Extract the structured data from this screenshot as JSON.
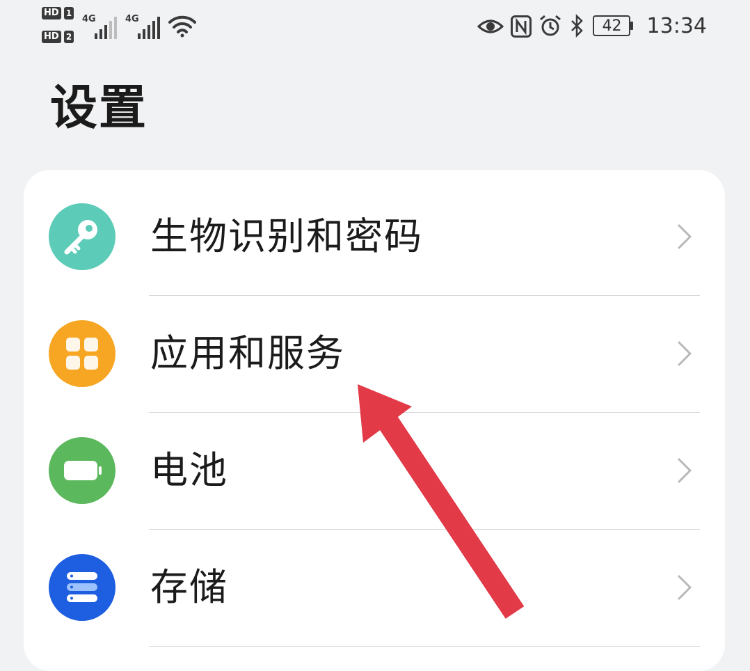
{
  "status_bar": {
    "sim1": {
      "hd": "HD",
      "slot": "1"
    },
    "sim2": {
      "hd": "HD",
      "slot": "2"
    },
    "signal1_label": "4G",
    "signal2_label": "4G",
    "battery_level": "42",
    "time": "13:34",
    "icons": [
      "eye-comfort-icon",
      "nfc-icon",
      "alarm-icon",
      "bluetooth-icon",
      "battery-icon"
    ]
  },
  "header": {
    "title": "设置"
  },
  "settings_list": [
    {
      "label": "生物识别和密码",
      "icon": "key-icon",
      "color": "#5ccbb7"
    },
    {
      "label": "应用和服务",
      "icon": "apps-grid-icon",
      "color": "#f6a623"
    },
    {
      "label": "电池",
      "icon": "battery-icon",
      "color": "#5cb85c"
    },
    {
      "label": "存储",
      "icon": "storage-icon",
      "color": "#1d5fe0"
    }
  ],
  "annotation": {
    "arrow_color": "#e63946"
  }
}
